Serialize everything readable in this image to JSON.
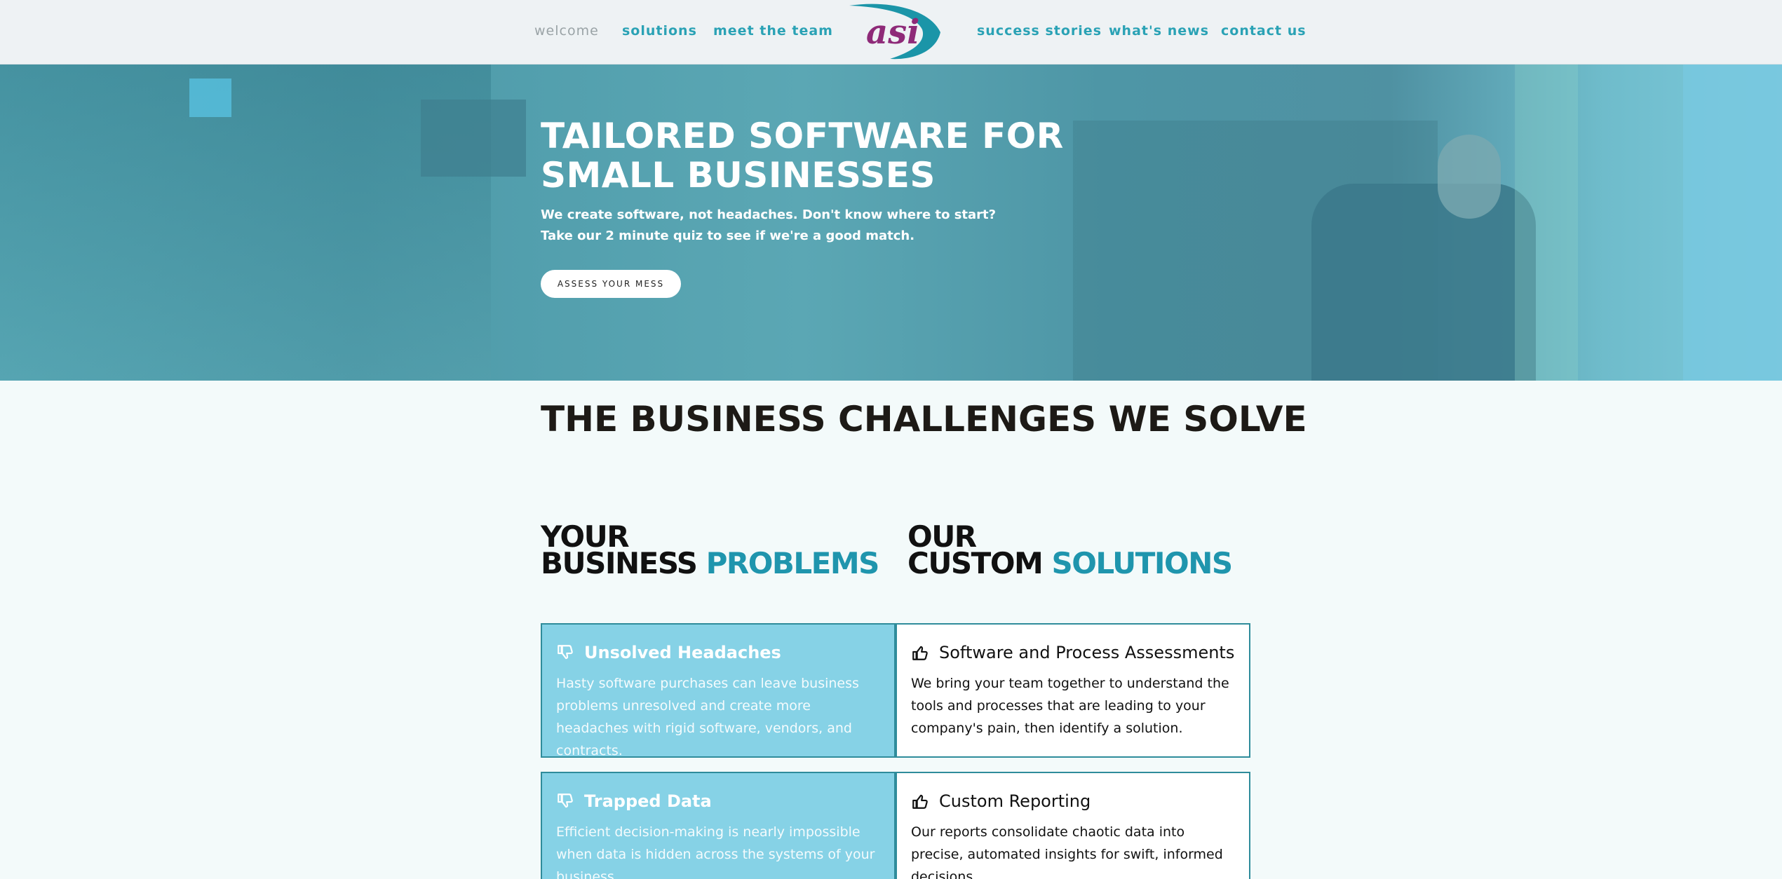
{
  "nav": {
    "left": [
      "welcome",
      "solutions",
      "meet the team"
    ],
    "right": [
      "success stories",
      "what's news",
      "contact us"
    ],
    "logo_text": "asi"
  },
  "hero": {
    "title": "TAILORED SOFTWARE FOR SMALL BUSINESSES",
    "subtitle_line1": "We create software, not headaches. Don't know where to start?",
    "subtitle_line2": "Take our 2 minute quiz to see if we're a good match.",
    "button": "ASSESS YOUR MESS"
  },
  "section": {
    "title": "THE BUSINESS CHALLENGES WE SOLVE",
    "problems_head_line1": "YOUR",
    "problems_head_line2": "BUSINESS",
    "problems_head_accent": "PROBLEMS",
    "solutions_head_line1": "OUR",
    "solutions_head_line2": "CUSTOM",
    "solutions_head_accent": "SOLUTIONS"
  },
  "cards": [
    {
      "problem_title": "Unsolved Headaches",
      "problem_text": "Hasty software purchases can leave business problems unresolved and create more headaches with rigid software, vendors, and contracts.",
      "solution_title": "Software and Process Assessments",
      "solution_text": "We bring your team together to understand the tools and processes that are leading to your company's pain, then identify a solution."
    },
    {
      "problem_title": "Trapped Data",
      "problem_text": "Efficient decision-making is nearly impossible when data is hidden across the systems of your business.",
      "solution_title": "Custom Reporting",
      "solution_text": "Our reports consolidate chaotic data into precise, automated insights for swift, informed decisions."
    }
  ],
  "colors": {
    "accent": "#2aa2b5",
    "problem_card": "#86d2e6",
    "logo_purple": "#8e2a78",
    "logo_teal": "#1b95a8"
  },
  "icons": {
    "problem": "thumbs-down-icon",
    "solution": "thumbs-up-icon"
  }
}
